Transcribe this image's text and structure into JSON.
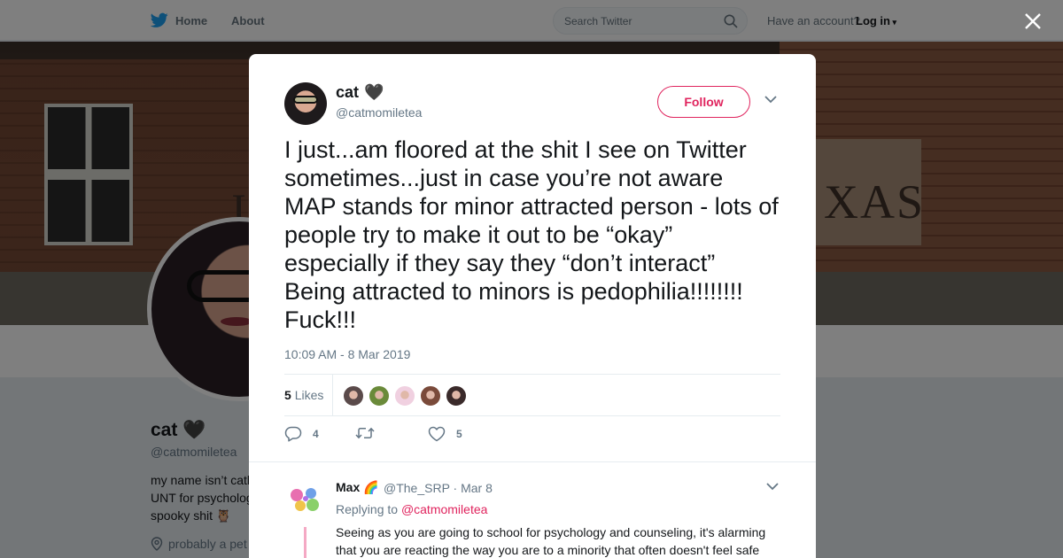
{
  "topbar": {
    "home_label": "Home",
    "about_label": "About",
    "search_placeholder": "Search Twitter",
    "have_account": "Have an account?",
    "login_label": "Log in"
  },
  "profile": {
    "name": "cat 🖤",
    "handle": "@catmomiletea",
    "bio_line_1": "my name isn’t catl",
    "bio_line_2": "UNT for psycholog",
    "bio_line_3": "spooky shit  🦉",
    "location": "probably a pet"
  },
  "banner": {
    "sign_text": "XAS",
    "sign_u": "U"
  },
  "tweet": {
    "author_name": "cat",
    "author_emoji": "🖤",
    "author_handle": "@catmomiletea",
    "follow_label": "Follow",
    "text": "I just...am floored at the shit I see on Twitter sometimes...just in case you’re not aware MAP stands for minor attracted person - lots of people try to make it out to be “okay” especially if they say they “don’t interact” Being attracted to minors is pedophilia!!!!!!!! Fuck!!!",
    "timestamp": "10:09 AM - 8 Mar 2019",
    "likes_count": "5",
    "likes_label": "Likes",
    "liker_colors": [
      "#5a4a4a",
      "#6a8a3a",
      "#f0d0e0",
      "#7a4a3a",
      "#3a2a2a"
    ],
    "reply_count": "4",
    "retweet_count": "",
    "like_count": "5"
  },
  "reply": {
    "name": "Max 🌈",
    "handle": "@The_SRP · Mar 8",
    "replying_label": "Replying to",
    "replying_to": "@catmomiletea",
    "text": "Seeing as you are going to school for psychology and counseling, it's alarming that you are reacting the way you are to a minority that often doesn't feel safe"
  },
  "colors": {
    "accent": "#e0245e",
    "muted": "#657786",
    "twitter_blue": "#1da1f2"
  }
}
